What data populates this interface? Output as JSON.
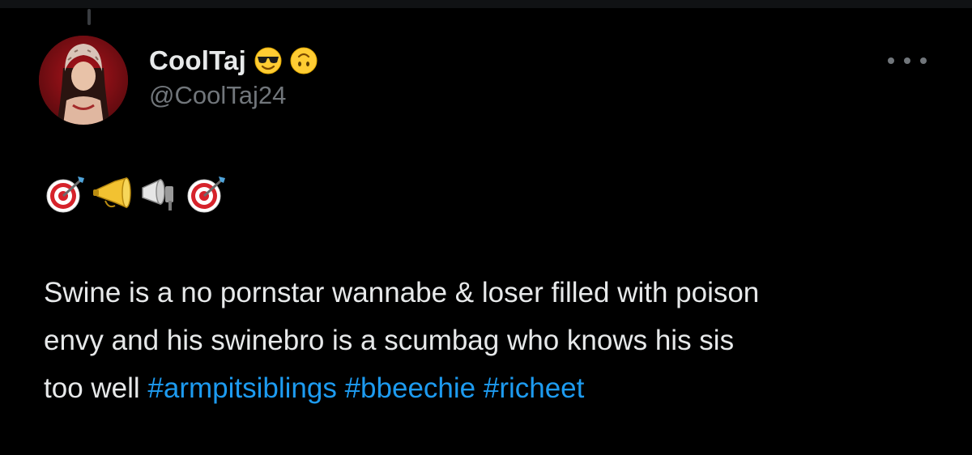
{
  "author": {
    "display_name": "CoolTaj",
    "handle": "@CoolTaj24",
    "name_emojis": [
      "smiling-face-with-sunglasses",
      "upside-down-face"
    ]
  },
  "tweet": {
    "emojis": [
      "direct-hit",
      "postal-horn",
      "megaphone",
      "direct-hit"
    ],
    "text_lines": [
      "Swine is a no pornstar wannabe & loser filled with poison",
      "envy and his swinebro is a scumbag who knows his sis",
      "too well"
    ],
    "hashtags": [
      "#armpitsiblings",
      "#bbeechie",
      "#richeet"
    ]
  },
  "colors": {
    "background": "#000000",
    "text": "#e7e9ea",
    "secondary_text": "#71767b",
    "link": "#1d9bf0"
  }
}
